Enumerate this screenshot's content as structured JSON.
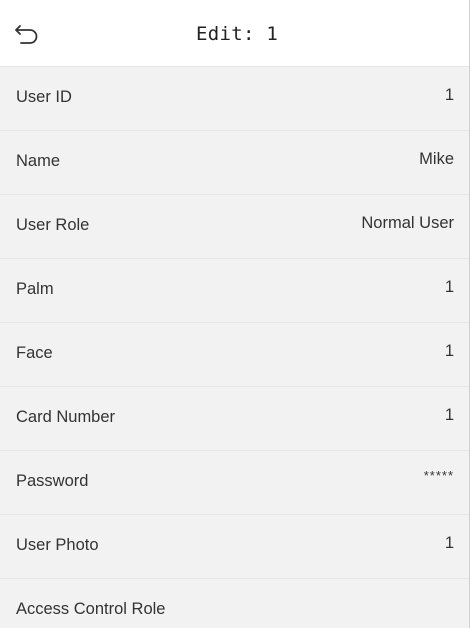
{
  "header": {
    "title": "Edit: 1",
    "back_icon": "back-arrow-icon"
  },
  "fields": [
    {
      "label": "User ID",
      "value": "1"
    },
    {
      "label": "Name",
      "value": "Mike"
    },
    {
      "label": "User Role",
      "value": "Normal User"
    },
    {
      "label": "Palm",
      "value": "1"
    },
    {
      "label": "Face",
      "value": "1"
    },
    {
      "label": "Card Number",
      "value": "1"
    },
    {
      "label": "Password",
      "value": "*****"
    },
    {
      "label": "User Photo",
      "value": "1"
    },
    {
      "label": "Access Control Role",
      "value": ""
    }
  ],
  "colors": {
    "background": "#ffffff",
    "row_background": "#f2f2f2",
    "divider": "#e6e6e6",
    "text": "#333333"
  }
}
